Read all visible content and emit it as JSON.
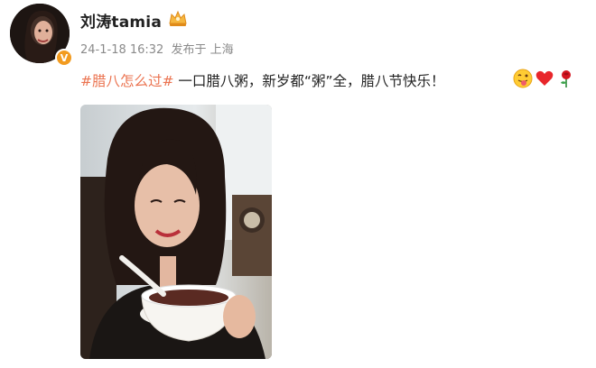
{
  "user": {
    "name": "刘涛tamia",
    "badge_icon": "crown-icon",
    "verified_icon": "verified-v-icon",
    "verified_symbol": "V"
  },
  "meta": {
    "timestamp": "24-1-18 16:32",
    "location": "发布于 上海"
  },
  "post": {
    "hashtag": "#腊八怎么过#",
    "text": " 一口腊八粥，新岁都“粥”全，腊八节快乐！",
    "emojis": [
      "tongue-out-emoji",
      "red-heart-emoji",
      "rose-emoji"
    ]
  },
  "colors": {
    "hashtag": "#eb7350",
    "meta": "#8a8a8a",
    "verified": "#f29b20"
  }
}
